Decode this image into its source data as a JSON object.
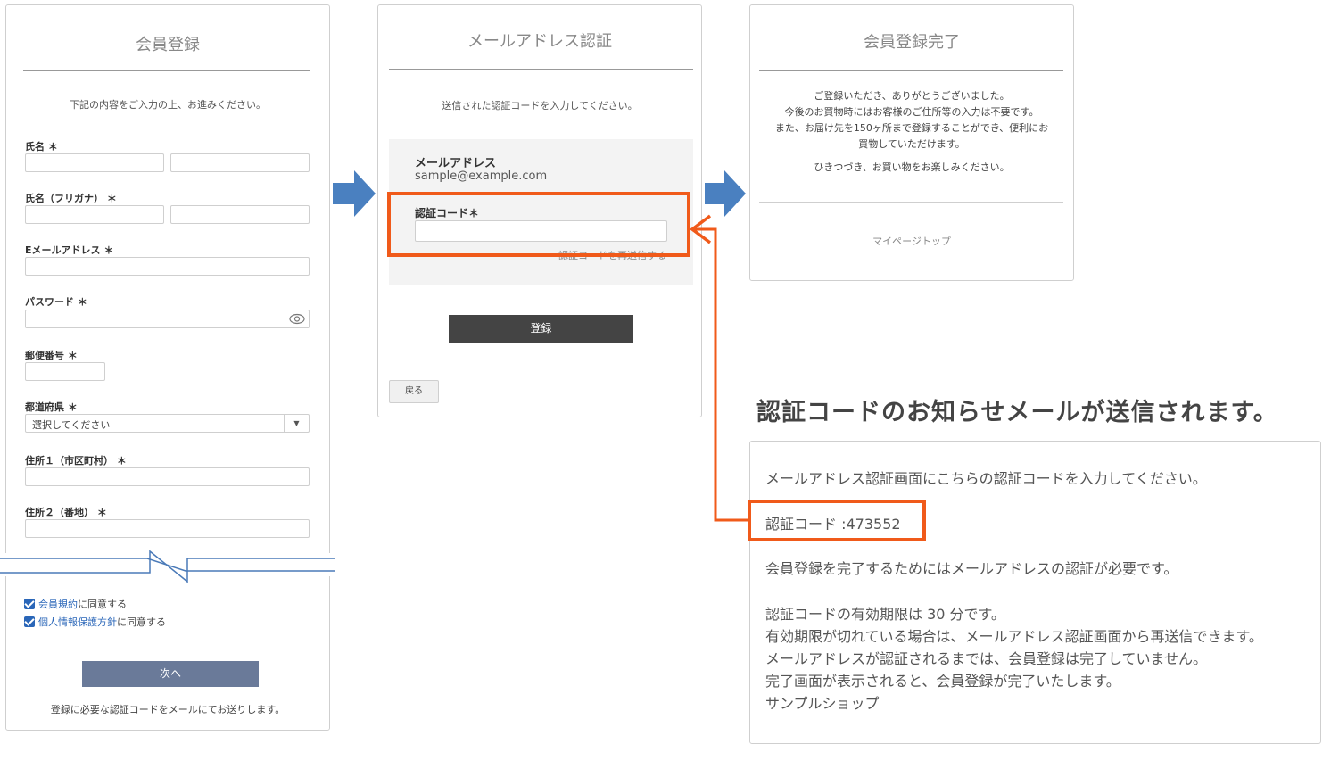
{
  "signup": {
    "title": "会員登録",
    "intro": "下記の内容をご入力の上、お進みください。",
    "name_label": "氏名 ＊",
    "kana_label": "氏名（フリガナ） ＊",
    "email_label": "Eメールアドレス ＊",
    "password_label": "パスワード ＊",
    "postal_label": "郵便番号 ＊",
    "prefecture_label": "都道府県 ＊",
    "prefecture_value": "選択してください",
    "address1_label": "住所１（市区町村） ＊",
    "address2_label": "住所２（番地） ＊",
    "terms_link": "会員規約",
    "terms_suffix": "に同意する",
    "privacy_link": "個人情報保護方針",
    "privacy_suffix": "に同意する",
    "next_button": "次へ",
    "footer_note": "登録に必要な認証コードをメールにてお送りします。"
  },
  "verify": {
    "title": "メールアドレス認証",
    "intro": "送信された認証コードを入力してください。",
    "email_label": "メールアドレス",
    "email_value": "sample@example.com",
    "code_label": "認証コード＊",
    "resend_link": "認証コードを再送信する",
    "register_button": "登録",
    "back_button": "戻る"
  },
  "complete": {
    "title": "会員登録完了",
    "line1": "ご登録いただき、ありがとうございました。",
    "line2": "今後のお買物時にはお客様のご住所等の入力は不要です。",
    "line3": "また、お届け先を150ヶ所まで登録することができ、便利にお",
    "line4": "買物していただけます。",
    "line5": "ひきつづき、お買い物をお楽しみください。",
    "mypage_link": "マイページトップ"
  },
  "headline": "認証コードのお知らせメールが送信されます。",
  "email": {
    "line1": "メールアドレス認証画面にこちらの認証コードを入力してください。",
    "code_line": "認証コード :473552",
    "line2": "会員登録を完了するためにはメールアドレスの認証が必要です。",
    "line3": "認証コードの有効期限は 30 分です。",
    "line4": "有効期限が切れている場合は、メールアドレス認証画面から再送信できます。",
    "line5": "メールアドレスが認証されるまでは、会員登録は完了していません。",
    "line6": "完了画面が表示されると、会員登録が完了いたします。",
    "line7": "サンプルショップ"
  },
  "colors": {
    "highlight": "#f05a1a",
    "flow_arrow": "#4a80c0",
    "next_button": "#6a7a99",
    "register_button": "#444444",
    "link": "#2a66b8"
  }
}
